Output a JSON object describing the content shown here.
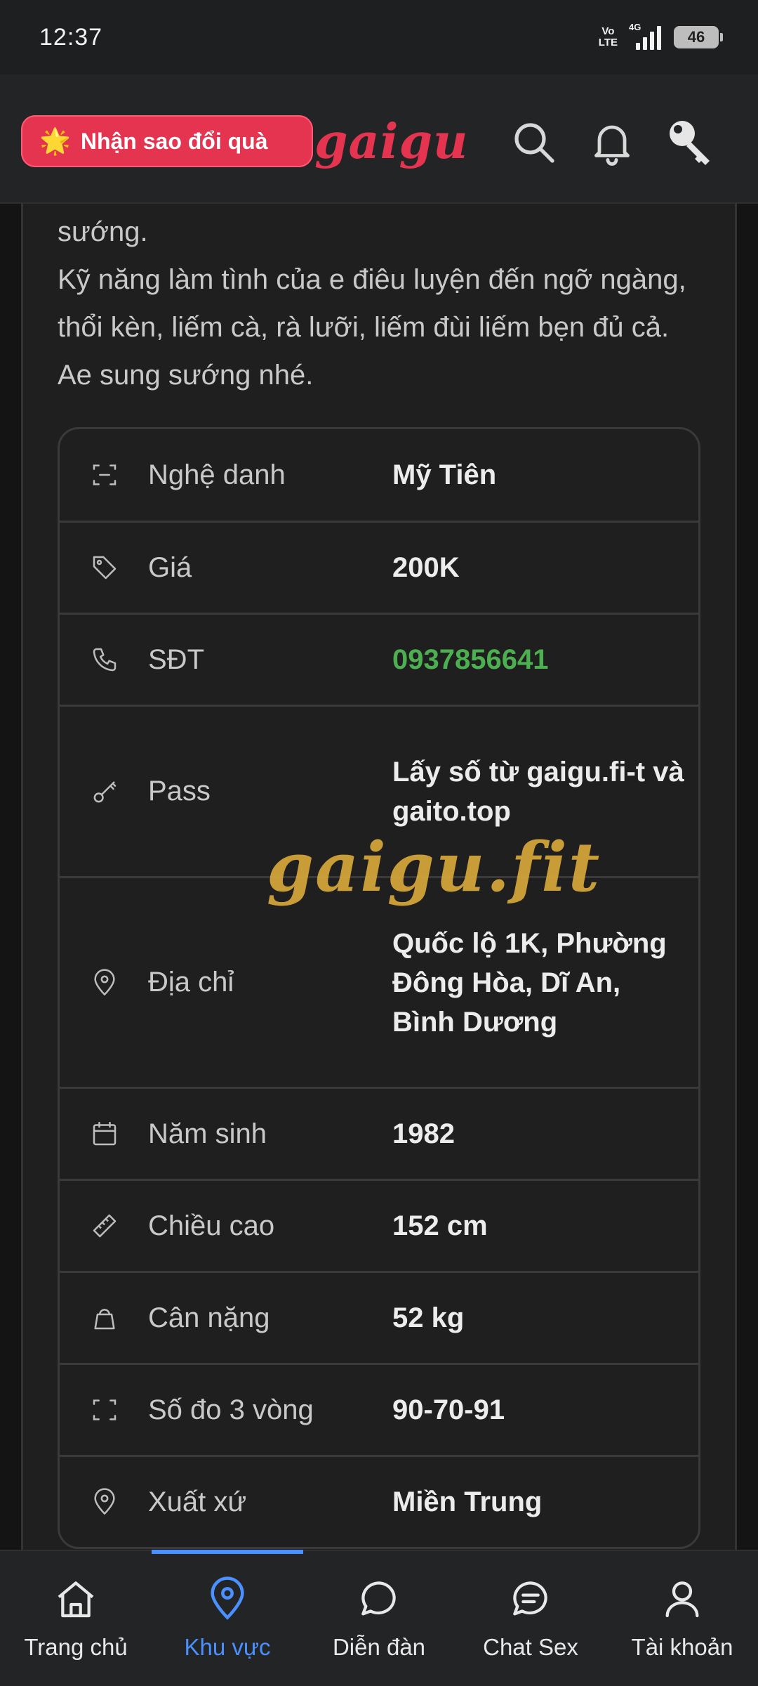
{
  "status": {
    "time": "12:37",
    "volte": "Vo\nLTE",
    "network": "4G",
    "battery": "46"
  },
  "header": {
    "promo_label": "Nhận sao đổi quà",
    "promo_star": "🌟",
    "logo": "gaigu"
  },
  "post": {
    "paragraph_line1": "sướng.",
    "paragraph_line2": "Kỹ năng làm tình của e điêu luyện đến ngỡ ngàng, thổi kèn, liếm cà, rà lưỡi, liếm đùi liếm bẹn đủ cả. Ae sung sướng nhé.",
    "watermark": "gaigu.fit"
  },
  "info": [
    {
      "icon": "id-frame-icon",
      "label": "Nghệ danh",
      "value": "Mỹ Tiên"
    },
    {
      "icon": "price-tag-icon",
      "label": "Giá",
      "value": "200K"
    },
    {
      "icon": "phone-icon",
      "label": "SĐT",
      "value": "0937856641"
    },
    {
      "icon": "key-icon",
      "label": "Pass",
      "value": "Lấy số từ gaigu.fi-t và gaito.top"
    },
    {
      "icon": "location-pin-icon",
      "label": "Địa chỉ",
      "value": "Quốc lộ 1K, Phường Đông Hòa, Dĩ An, Bình Dương"
    },
    {
      "icon": "calendar-icon",
      "label": "Năm sinh",
      "value": "1982"
    },
    {
      "icon": "ruler-icon",
      "label": "Chiều cao",
      "value": "152 cm"
    },
    {
      "icon": "weight-icon",
      "label": "Cân nặng",
      "value": "52 kg"
    },
    {
      "icon": "measure-frame-icon",
      "label": "Số đo 3 vòng",
      "value": "90-70-91"
    },
    {
      "icon": "location-pin-icon",
      "label": "Xuất xứ",
      "value": "Miền Trung"
    }
  ],
  "nav": [
    {
      "icon": "home-icon",
      "label": "Trang chủ",
      "active": false
    },
    {
      "icon": "location-pin-icon",
      "label": "Khu vực",
      "active": true
    },
    {
      "icon": "chat-bubble-icon",
      "label": "Diễn đàn",
      "active": false
    },
    {
      "icon": "chat-lines-icon",
      "label": "Chat Sex",
      "active": false
    },
    {
      "icon": "user-icon",
      "label": "Tài khoản",
      "active": false
    }
  ],
  "colors": {
    "accent": "#e5344f",
    "active_nav": "#4a90ff",
    "phone": "#4caf50",
    "watermark": "#d7a73a"
  }
}
